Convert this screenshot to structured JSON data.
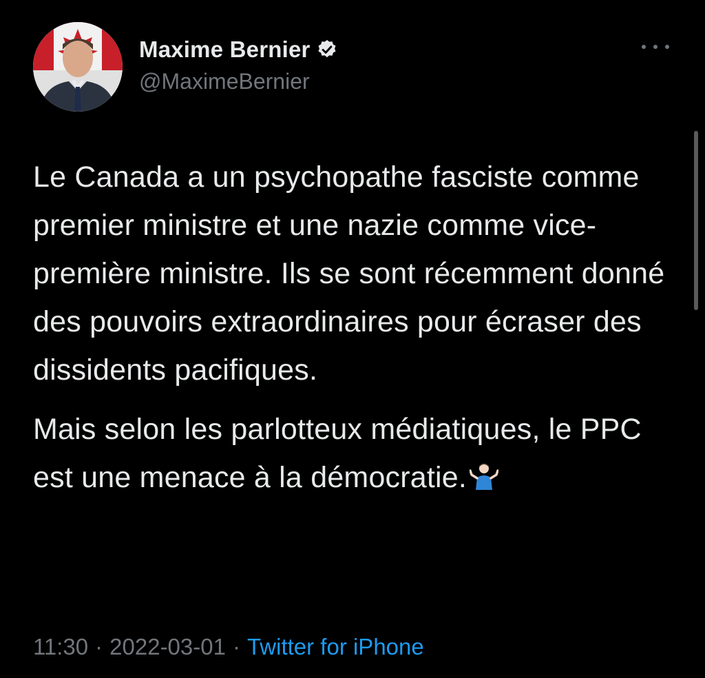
{
  "author": {
    "display_name": "Maxime Bernier",
    "handle": "@MaximeBernier",
    "verified": true
  },
  "tweet": {
    "paragraphs": [
      "Le Canada a un psychopathe fasciste comme premier ministre et une nazie comme vice-première ministre. Ils se sont récemment donné des pouvoirs extraordinaires pour écraser des dissidents pacifiques.",
      "Mais selon les parlotteux médiatiques, le PPC est une menace à la démocratie."
    ],
    "emoji": "person-shrugging"
  },
  "meta": {
    "time": "11:30",
    "separator": "·",
    "date": "2022-03-01",
    "source": "Twitter for iPhone"
  },
  "icons": {
    "verified": "verified-badge-icon",
    "more": "more-options-icon"
  },
  "colors": {
    "background": "#000000",
    "primary_text": "#e7e9ea",
    "secondary_text": "#71767b",
    "link": "#1d9bf0"
  }
}
